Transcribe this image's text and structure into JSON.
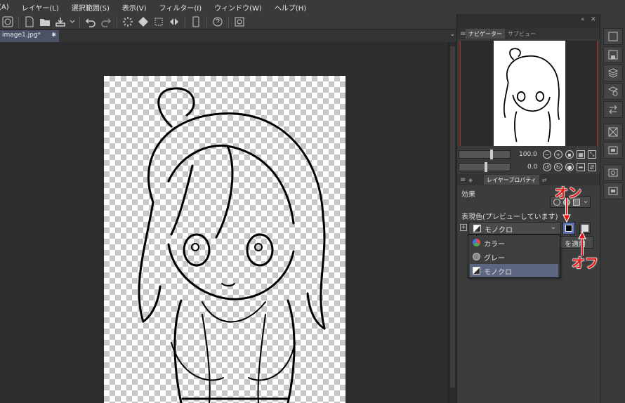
{
  "menu": [
    "(A)",
    "レイヤー(L)",
    "選択範囲(S)",
    "表示(V)",
    "フィルター(I)",
    "ウィンドウ(W)",
    "ヘルプ(H)"
  ],
  "document": {
    "tab_title": "image1.jpg*",
    "close_glyph": "✱"
  },
  "navigator": {
    "tab_active": "ナビゲーター",
    "tab_inactive": "サブビュー",
    "zoom": "100.0",
    "rotation": "0.0"
  },
  "layer_panel": {
    "tab_active": "レイヤープロパティ",
    "effects_label": "効果",
    "expression_label": "表現色(プレビューしています)",
    "expression_value": "モノクロ",
    "apply_label": "を適用",
    "options": [
      "カラー",
      "グレー",
      "モノクロ"
    ]
  },
  "annotations": {
    "on": "オン",
    "off": "オフ"
  },
  "colors": {
    "annotation": "#e41616",
    "selected_row": "#5c6680",
    "swatch_active_bg": "#5b6fb0"
  },
  "icons": [
    "menu-icon",
    "new-file-icon",
    "open-folder-icon",
    "save-icon",
    "undo-icon",
    "redo-icon",
    "loading-icon",
    "fill-icon",
    "transform-icon",
    "flip-icon",
    "device-icon",
    "help-icon",
    "search-icon"
  ]
}
